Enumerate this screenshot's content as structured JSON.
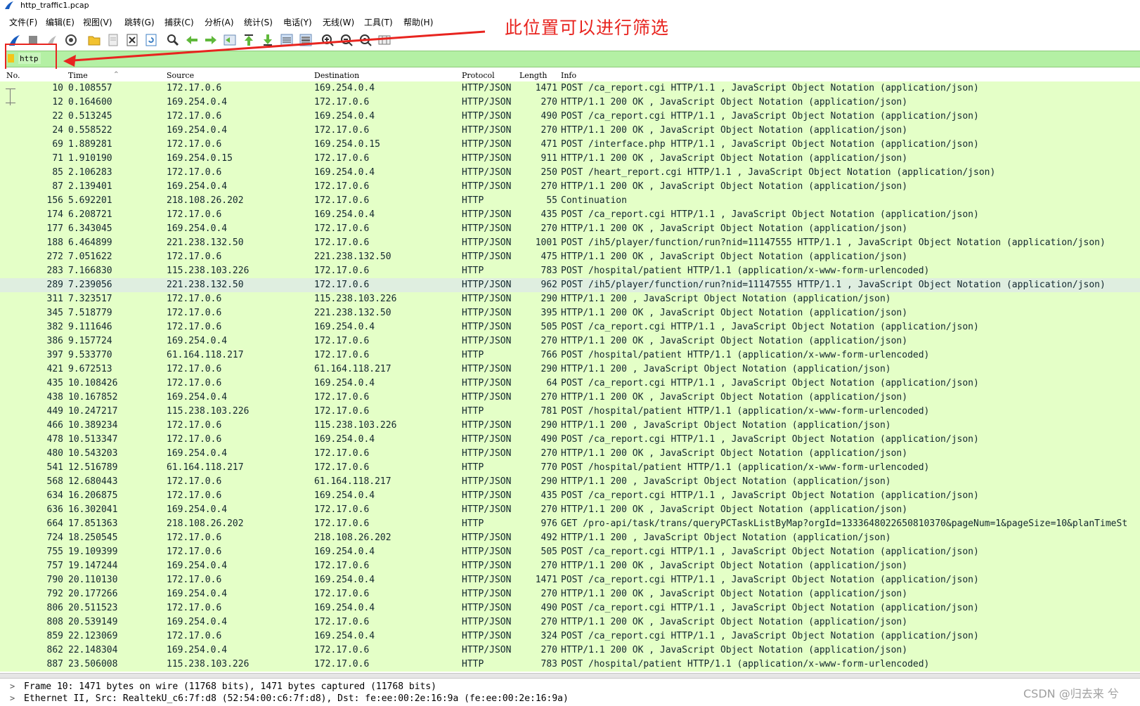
{
  "window": {
    "title": "http_traffic1.pcap"
  },
  "menu": [
    "文件(F)",
    "编辑(E)",
    "视图(V)",
    "跳转(G)",
    "捕获(C)",
    "分析(A)",
    "统计(S)",
    "电话(Y)",
    "无线(W)",
    "工具(T)",
    "帮助(H)"
  ],
  "annotation": {
    "text": "此位置可以进行筛选"
  },
  "filter": {
    "value": "http"
  },
  "columns": {
    "no": "No.",
    "time": "Time",
    "source": "Source",
    "destination": "Destination",
    "protocol": "Protocol",
    "length": "Length",
    "info": "Info"
  },
  "packets": [
    {
      "no": "10",
      "time": "0.108557",
      "src": "172.17.0.6",
      "dst": "169.254.0.4",
      "proto": "HTTP/JSON",
      "len": "1471",
      "info": "POST /ca_report.cgi HTTP/1.1 , JavaScript Object Notation (application/json)"
    },
    {
      "no": "12",
      "time": "0.164600",
      "src": "169.254.0.4",
      "dst": "172.17.0.6",
      "proto": "HTTP/JSON",
      "len": "270",
      "info": "HTTP/1.1 200 OK , JavaScript Object Notation (application/json)"
    },
    {
      "no": "22",
      "time": "0.513245",
      "src": "172.17.0.6",
      "dst": "169.254.0.4",
      "proto": "HTTP/JSON",
      "len": "490",
      "info": "POST /ca_report.cgi HTTP/1.1 , JavaScript Object Notation (application/json)"
    },
    {
      "no": "24",
      "time": "0.558522",
      "src": "169.254.0.4",
      "dst": "172.17.0.6",
      "proto": "HTTP/JSON",
      "len": "270",
      "info": "HTTP/1.1 200 OK , JavaScript Object Notation (application/json)"
    },
    {
      "no": "69",
      "time": "1.889281",
      "src": "172.17.0.6",
      "dst": "169.254.0.15",
      "proto": "HTTP/JSON",
      "len": "471",
      "info": "POST /interface.php HTTP/1.1 , JavaScript Object Notation (application/json)"
    },
    {
      "no": "71",
      "time": "1.910190",
      "src": "169.254.0.15",
      "dst": "172.17.0.6",
      "proto": "HTTP/JSON",
      "len": "911",
      "info": "HTTP/1.1 200 OK , JavaScript Object Notation (application/json)"
    },
    {
      "no": "85",
      "time": "2.106283",
      "src": "172.17.0.6",
      "dst": "169.254.0.4",
      "proto": "HTTP/JSON",
      "len": "250",
      "info": "POST /heart_report.cgi HTTP/1.1 , JavaScript Object Notation (application/json)"
    },
    {
      "no": "87",
      "time": "2.139401",
      "src": "169.254.0.4",
      "dst": "172.17.0.6",
      "proto": "HTTP/JSON",
      "len": "270",
      "info": "HTTP/1.1 200 OK , JavaScript Object Notation (application/json)"
    },
    {
      "no": "156",
      "time": "5.692201",
      "src": "218.108.26.202",
      "dst": "172.17.0.6",
      "proto": "HTTP",
      "len": "55",
      "info": "Continuation"
    },
    {
      "no": "174",
      "time": "6.208721",
      "src": "172.17.0.6",
      "dst": "169.254.0.4",
      "proto": "HTTP/JSON",
      "len": "435",
      "info": "POST /ca_report.cgi HTTP/1.1 , JavaScript Object Notation (application/json)"
    },
    {
      "no": "177",
      "time": "6.343045",
      "src": "169.254.0.4",
      "dst": "172.17.0.6",
      "proto": "HTTP/JSON",
      "len": "270",
      "info": "HTTP/1.1 200 OK , JavaScript Object Notation (application/json)"
    },
    {
      "no": "188",
      "time": "6.464899",
      "src": "221.238.132.50",
      "dst": "172.17.0.6",
      "proto": "HTTP/JSON",
      "len": "1001",
      "info": "POST /ih5/player/function/run?nid=11147555 HTTP/1.1 , JavaScript Object Notation (application/json)"
    },
    {
      "no": "272",
      "time": "7.051622",
      "src": "172.17.0.6",
      "dst": "221.238.132.50",
      "proto": "HTTP/JSON",
      "len": "475",
      "info": "HTTP/1.1 200 OK , JavaScript Object Notation (application/json)"
    },
    {
      "no": "283",
      "time": "7.166830",
      "src": "115.238.103.226",
      "dst": "172.17.0.6",
      "proto": "HTTP",
      "len": "783",
      "info": "POST /hospital/patient HTTP/1.1  (application/x-www-form-urlencoded)"
    },
    {
      "no": "289",
      "time": "7.239056",
      "src": "221.238.132.50",
      "dst": "172.17.0.6",
      "proto": "HTTP/JSON",
      "len": "962",
      "info": "POST /ih5/player/function/run?nid=11147555 HTTP/1.1 , JavaScript Object Notation (application/json)"
    },
    {
      "no": "311",
      "time": "7.323517",
      "src": "172.17.0.6",
      "dst": "115.238.103.226",
      "proto": "HTTP/JSON",
      "len": "290",
      "info": "HTTP/1.1 200  , JavaScript Object Notation (application/json)"
    },
    {
      "no": "345",
      "time": "7.518779",
      "src": "172.17.0.6",
      "dst": "221.238.132.50",
      "proto": "HTTP/JSON",
      "len": "395",
      "info": "HTTP/1.1 200 OK , JavaScript Object Notation (application/json)"
    },
    {
      "no": "382",
      "time": "9.111646",
      "src": "172.17.0.6",
      "dst": "169.254.0.4",
      "proto": "HTTP/JSON",
      "len": "505",
      "info": "POST /ca_report.cgi HTTP/1.1 , JavaScript Object Notation (application/json)"
    },
    {
      "no": "386",
      "time": "9.157724",
      "src": "169.254.0.4",
      "dst": "172.17.0.6",
      "proto": "HTTP/JSON",
      "len": "270",
      "info": "HTTP/1.1 200 OK , JavaScript Object Notation (application/json)"
    },
    {
      "no": "397",
      "time": "9.533770",
      "src": "61.164.118.217",
      "dst": "172.17.0.6",
      "proto": "HTTP",
      "len": "766",
      "info": "POST /hospital/patient HTTP/1.1  (application/x-www-form-urlencoded)"
    },
    {
      "no": "421",
      "time": "9.672513",
      "src": "172.17.0.6",
      "dst": "61.164.118.217",
      "proto": "HTTP/JSON",
      "len": "290",
      "info": "HTTP/1.1 200  , JavaScript Object Notation (application/json)"
    },
    {
      "no": "435",
      "time": "10.108426",
      "src": "172.17.0.6",
      "dst": "169.254.0.4",
      "proto": "HTTP/JSON",
      "len": "64",
      "info": "POST /ca_report.cgi HTTP/1.1 , JavaScript Object Notation (application/json)"
    },
    {
      "no": "438",
      "time": "10.167852",
      "src": "169.254.0.4",
      "dst": "172.17.0.6",
      "proto": "HTTP/JSON",
      "len": "270",
      "info": "HTTP/1.1 200 OK , JavaScript Object Notation (application/json)"
    },
    {
      "no": "449",
      "time": "10.247217",
      "src": "115.238.103.226",
      "dst": "172.17.0.6",
      "proto": "HTTP",
      "len": "781",
      "info": "POST /hospital/patient HTTP/1.1  (application/x-www-form-urlencoded)"
    },
    {
      "no": "466",
      "time": "10.389234",
      "src": "172.17.0.6",
      "dst": "115.238.103.226",
      "proto": "HTTP/JSON",
      "len": "290",
      "info": "HTTP/1.1 200  , JavaScript Object Notation (application/json)"
    },
    {
      "no": "478",
      "time": "10.513347",
      "src": "172.17.0.6",
      "dst": "169.254.0.4",
      "proto": "HTTP/JSON",
      "len": "490",
      "info": "POST /ca_report.cgi HTTP/1.1 , JavaScript Object Notation (application/json)"
    },
    {
      "no": "480",
      "time": "10.543203",
      "src": "169.254.0.4",
      "dst": "172.17.0.6",
      "proto": "HTTP/JSON",
      "len": "270",
      "info": "HTTP/1.1 200 OK , JavaScript Object Notation (application/json)"
    },
    {
      "no": "541",
      "time": "12.516789",
      "src": "61.164.118.217",
      "dst": "172.17.0.6",
      "proto": "HTTP",
      "len": "770",
      "info": "POST /hospital/patient HTTP/1.1  (application/x-www-form-urlencoded)"
    },
    {
      "no": "568",
      "time": "12.680443",
      "src": "172.17.0.6",
      "dst": "61.164.118.217",
      "proto": "HTTP/JSON",
      "len": "290",
      "info": "HTTP/1.1 200  , JavaScript Object Notation (application/json)"
    },
    {
      "no": "634",
      "time": "16.206875",
      "src": "172.17.0.6",
      "dst": "169.254.0.4",
      "proto": "HTTP/JSON",
      "len": "435",
      "info": "POST /ca_report.cgi HTTP/1.1 , JavaScript Object Notation (application/json)"
    },
    {
      "no": "636",
      "time": "16.302041",
      "src": "169.254.0.4",
      "dst": "172.17.0.6",
      "proto": "HTTP/JSON",
      "len": "270",
      "info": "HTTP/1.1 200 OK , JavaScript Object Notation (application/json)"
    },
    {
      "no": "664",
      "time": "17.851363",
      "src": "218.108.26.202",
      "dst": "172.17.0.6",
      "proto": "HTTP",
      "len": "976",
      "info": "GET /pro-api/task/trans/queryPCTaskListByMap?orgId=1333648022650810370&pageNum=1&pageSize=10&planTimeSt"
    },
    {
      "no": "724",
      "time": "18.250545",
      "src": "172.17.0.6",
      "dst": "218.108.26.202",
      "proto": "HTTP/JSON",
      "len": "492",
      "info": "HTTP/1.1 200  , JavaScript Object Notation (application/json)"
    },
    {
      "no": "755",
      "time": "19.109399",
      "src": "172.17.0.6",
      "dst": "169.254.0.4",
      "proto": "HTTP/JSON",
      "len": "505",
      "info": "POST /ca_report.cgi HTTP/1.1 , JavaScript Object Notation (application/json)"
    },
    {
      "no": "757",
      "time": "19.147244",
      "src": "169.254.0.4",
      "dst": "172.17.0.6",
      "proto": "HTTP/JSON",
      "len": "270",
      "info": "HTTP/1.1 200 OK , JavaScript Object Notation (application/json)"
    },
    {
      "no": "790",
      "time": "20.110130",
      "src": "172.17.0.6",
      "dst": "169.254.0.4",
      "proto": "HTTP/JSON",
      "len": "1471",
      "info": "POST /ca_report.cgi HTTP/1.1 , JavaScript Object Notation (application/json)"
    },
    {
      "no": "792",
      "time": "20.177266",
      "src": "169.254.0.4",
      "dst": "172.17.0.6",
      "proto": "HTTP/JSON",
      "len": "270",
      "info": "HTTP/1.1 200 OK , JavaScript Object Notation (application/json)"
    },
    {
      "no": "806",
      "time": "20.511523",
      "src": "172.17.0.6",
      "dst": "169.254.0.4",
      "proto": "HTTP/JSON",
      "len": "490",
      "info": "POST /ca_report.cgi HTTP/1.1 , JavaScript Object Notation (application/json)"
    },
    {
      "no": "808",
      "time": "20.539149",
      "src": "169.254.0.4",
      "dst": "172.17.0.6",
      "proto": "HTTP/JSON",
      "len": "270",
      "info": "HTTP/1.1 200 OK , JavaScript Object Notation (application/json)"
    },
    {
      "no": "859",
      "time": "22.123069",
      "src": "172.17.0.6",
      "dst": "169.254.0.4",
      "proto": "HTTP/JSON",
      "len": "324",
      "info": "POST /ca_report.cgi HTTP/1.1 , JavaScript Object Notation (application/json)"
    },
    {
      "no": "862",
      "time": "22.148304",
      "src": "169.254.0.4",
      "dst": "172.17.0.6",
      "proto": "HTTP/JSON",
      "len": "270",
      "info": "HTTP/1.1 200 OK , JavaScript Object Notation (application/json)"
    },
    {
      "no": "887",
      "time": "23.506008",
      "src": "115.238.103.226",
      "dst": "172.17.0.6",
      "proto": "HTTP",
      "len": "783",
      "info": "POST /hospital/patient HTTP/1.1  (application/x-www-form-urlencoded)"
    }
  ],
  "selected_packet_no": "289",
  "details": [
    "Frame 10: 1471 bytes on wire (11768 bits), 1471 bytes captured (11768 bits)",
    "Ethernet II, Src: RealtekU_c6:7f:d8 (52:54:00:c6:7f:d8), Dst: fe:ee:00:2e:16:9a (fe:ee:00:2e:16:9a)"
  ],
  "watermark": "CSDN @归去来 兮",
  "colors": {
    "row_bg": "#e4ffc7",
    "filter_bg": "#b4f0a4",
    "annotation": "#e8241f"
  }
}
